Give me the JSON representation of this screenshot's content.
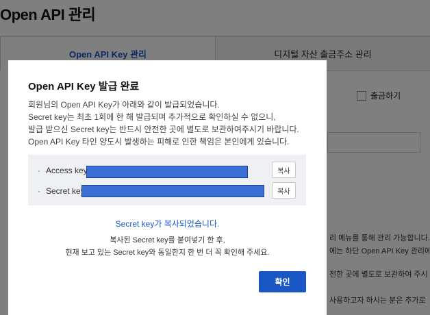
{
  "page": {
    "title": "Open API 관리",
    "tabs": [
      {
        "label": "Open API Key 관리",
        "active": true
      },
      {
        "label": "디지털 자산 출금주소 관리",
        "active": false
      }
    ],
    "withdraw_checkbox_label": "출금하기",
    "bg_texts": [
      "리 메뉴를 통해 관리 가능합니다.",
      "에는 하단 Open API Key 관리에",
      "전한 곳에 별도로 보관하여 주시",
      "사용하고자 하시는 분은 추가로"
    ]
  },
  "modal": {
    "title": "Open API Key 발급 완료",
    "description": [
      "회원님의 Open API Key가 아래와 같이 발급되었습니다.",
      "Secret key는 최초 1회에 한 해 발급되며 추가적으로 확인하실 수 없으니,",
      "발급 받으신 Secret key는 반드시 안전한 곳에 별도로 보관하여주시기 바랍니다.",
      "Open API Key 타인 양도시 발생하는 피해로 인한 책임은 본인에게 있습니다."
    ],
    "keys": [
      {
        "label": "Access key",
        "copy_label": "복사"
      },
      {
        "label": "Secret key",
        "copy_label": "복사"
      }
    ],
    "copied_message": "Secret key가 복사되었습니다.",
    "note": [
      "복사된 Secret key를 붙여넣기 한 후,",
      "현재 보고 있는 Secret key와 동일한지 한 번 더 꼭 확인해 주세요."
    ],
    "confirm_label": "확인"
  },
  "colors": {
    "accent": "#1a56c4",
    "masked_key": "#3b6fd6",
    "overlay": "rgba(0,0,0,0.5)"
  }
}
